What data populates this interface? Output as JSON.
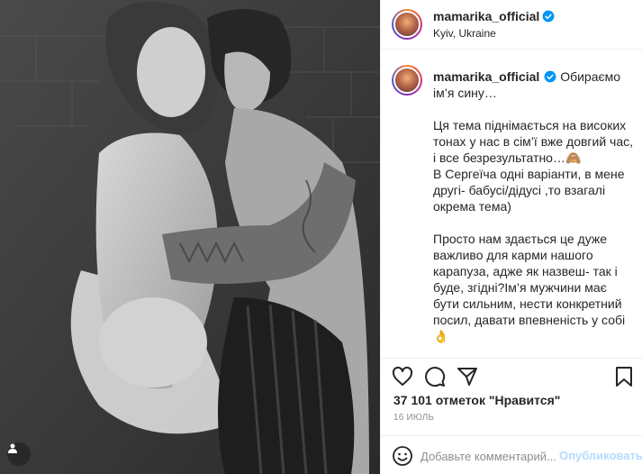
{
  "post": {
    "author": {
      "username": "mamarika_official",
      "verified": true,
      "location": "Kyiv, Ukraine"
    },
    "photo": {
      "badge_icon": "user-tag-icon"
    },
    "caption": {
      "text": "Обираємо ім’я сину…\n\nЦя тема піднімається на високих тонах у нас в сім’ї вже довгий час, і все безрезультатно…🙈\nВ Сергеїча одні варіанти, в мене другі- бабусі/дідусі ,то взагалі окрема тема)\n\nПросто нам здається це дуже важливо для карми нашого карапуза, адже як назвеш- так і буде, згідні?Ім’я мужчини має бути сильним, нести конкретний посил, давати впевненість у собі👌\n\nКароч, наразі ніфіга не вирішили- тому\nпропонуємо вам, народ, помогти"
    },
    "actions": {
      "like_icon": "heart-icon",
      "comment_icon": "comment-icon",
      "share_icon": "share-icon",
      "save_icon": "bookmark-icon"
    },
    "likes_text": "37 101 отметок \"Нравится\"",
    "date": "16 ИЮЛЬ",
    "comment": {
      "emoji_icon": "emoji-icon",
      "placeholder": "Добавьте комментарий...",
      "publish_label": "Опубликовать"
    }
  },
  "colors": {
    "text": "#262626",
    "muted": "#8e8e8e",
    "verified": "#0095f6",
    "publish_disabled": "#b3dbff",
    "border": "#efefef"
  }
}
